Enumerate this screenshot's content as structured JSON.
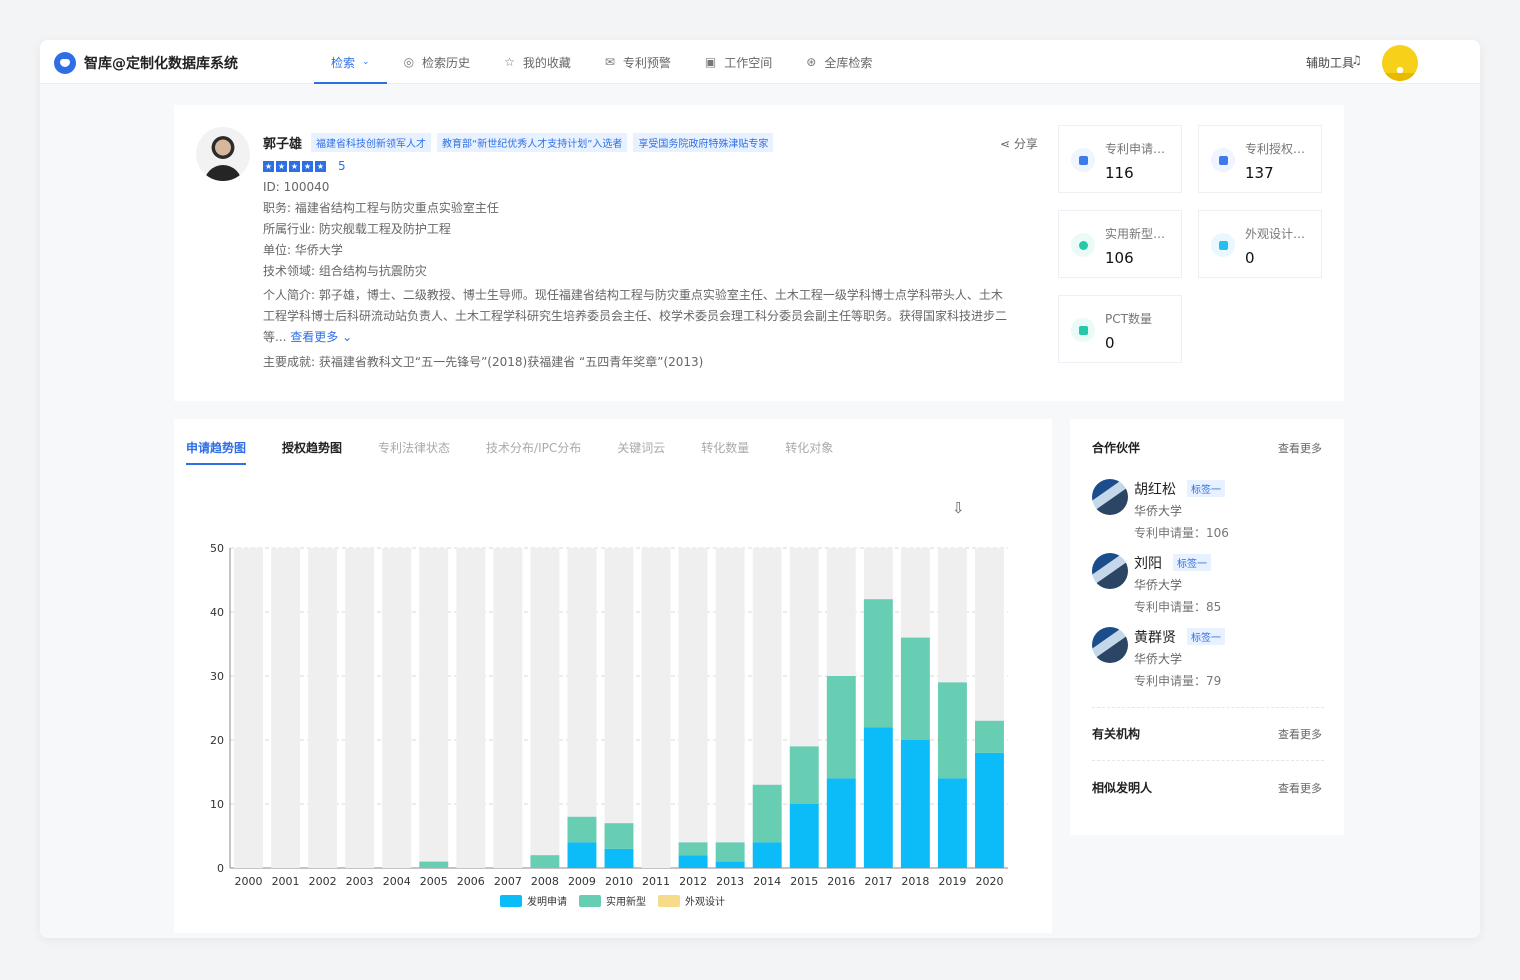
{
  "app": {
    "title": "智库@定制化数据库系统"
  },
  "nav": [
    {
      "label": "检索",
      "icon": "chevron-down-icon",
      "active": true
    },
    {
      "label": "检索历史",
      "icon": "history-icon"
    },
    {
      "label": "我的收藏",
      "icon": "star-icon"
    },
    {
      "label": "专利预警",
      "icon": "mail-icon"
    },
    {
      "label": "工作空间",
      "icon": "briefcase-icon"
    },
    {
      "label": "全库检索",
      "icon": "globe-icon"
    }
  ],
  "toolbar": {
    "tools_label": "辅助工具",
    "bell_icon": "bell-icon"
  },
  "profile": {
    "name": "郭子雄",
    "tags": [
      "福建省科技创新领军人才",
      "教育部“新世纪优秀人才支持计划”入选者",
      "享受国务院政府特殊津贴专家"
    ],
    "rating": "5",
    "share": "分享",
    "id": "ID:   100040",
    "position": "职务:   福建省结构工程与防灾重点实验室主任",
    "industry": "所属行业:   防灾舰载工程及防护工程",
    "unit": "单位:   华侨大学",
    "tech_field": "技术领域:   组合结构与抗震防灾",
    "intro_line1": "个人简介:    郭子雄，博士、二级教授、博士生导师。现任福建省结构工程与防灾重点实验室主任、土木工程一级学科博士点学科带头人、土木",
    "intro_line2": "工程学科博士后科研流动站负责人、土木工程学科研究生培养委员会主任、校学术委员会理工科分委员会副主任等职务。获得国家科技进步二",
    "intro_line3": "等... ",
    "more": "查看更多",
    "achievements": "主要成就:   获福建省教科文卫“五一先锋号”(2018)获福建省 “五四青年奖章”(2013)"
  },
  "stats": [
    {
      "label": "专利申请数量",
      "value": "116",
      "color": "#3d7bea"
    },
    {
      "label": "专利授权数量",
      "value": "137",
      "color": "#3d7bea"
    },
    {
      "label": "实用新型数量",
      "value": "106",
      "color": "#27c7a7"
    },
    {
      "label": "外观设计数量",
      "value": "0",
      "color": "#24c1f0"
    },
    {
      "label": "PCT数量",
      "value": "0",
      "color": "#27c7a7"
    }
  ],
  "tabs": [
    "申请趋势图",
    "授权趋势图",
    "专利法律状态",
    "技术分布/IPC分布",
    "关键词云",
    "转化数量",
    "转化对象"
  ],
  "chart_data": {
    "type": "bar",
    "stacked": true,
    "categories": [
      "2000",
      "2001",
      "2002",
      "2003",
      "2004",
      "2005",
      "2006",
      "2007",
      "2008",
      "2009",
      "2010",
      "2011",
      "2012",
      "2013",
      "2014",
      "2015",
      "2016",
      "2017",
      "2018",
      "2019",
      "2020"
    ],
    "series": [
      {
        "name": "发明申请",
        "color": "#0bbcf9",
        "values": [
          0,
          0,
          0,
          0,
          0,
          0,
          0,
          0,
          0,
          4,
          3,
          0,
          2,
          1,
          4,
          10,
          14,
          22,
          20,
          14,
          18
        ]
      },
      {
        "name": "实用新型",
        "color": "#67cdb3",
        "values": [
          0,
          0,
          0,
          0,
          0,
          1,
          0,
          0,
          2,
          4,
          4,
          0,
          2,
          3,
          9,
          9,
          16,
          20,
          16,
          15,
          5
        ]
      },
      {
        "name": "外观设计",
        "color": "#f6dc8a",
        "values": [
          0,
          0,
          0,
          0,
          0,
          0,
          0,
          0,
          0,
          0,
          0,
          0,
          0,
          0,
          0,
          0,
          0,
          0,
          0,
          0,
          0
        ]
      }
    ],
    "ylim": [
      0,
      50
    ],
    "yticks": [
      0,
      10,
      20,
      30,
      40,
      50
    ],
    "grid": true,
    "legend": "bottom-center"
  },
  "side": {
    "partners_title": "合作伙伴",
    "more": "查看更多",
    "partners": [
      {
        "name": "胡红松",
        "tag": "标签一",
        "org": "华侨大学",
        "count": "专利申请量：106"
      },
      {
        "name": "刘阳",
        "tag": "标签一",
        "org": "华侨大学",
        "count": "专利申请量：85"
      },
      {
        "name": "黄群贤",
        "tag": "标签一",
        "org": "华侨大学",
        "count": "专利申请量：79"
      }
    ],
    "institutions_title": "有关机构",
    "inventors_title": "相似发明人"
  }
}
